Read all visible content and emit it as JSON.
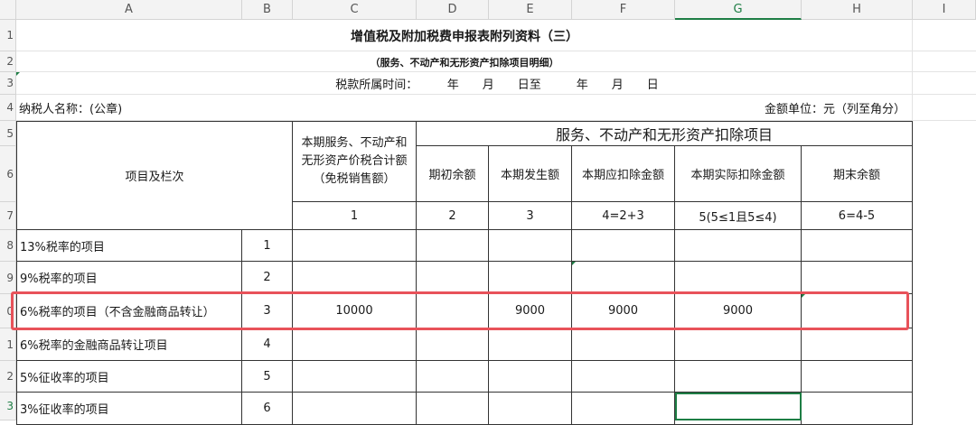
{
  "columns": [
    "A",
    "B",
    "C",
    "D",
    "E",
    "F",
    "G",
    "H",
    "I"
  ],
  "rows": [
    "1",
    "2",
    "3",
    "4",
    "5",
    "6",
    "7",
    "8",
    "9",
    "0",
    "1",
    "2",
    "3"
  ],
  "sheet": {
    "title": "增值税及附加税费申报表附列资料（三）",
    "subtitle": "（服务、不动产和无形资产扣除项目明细）",
    "period": "税款所属时间：　　　年　　月　　日至　　　年　　月　　日",
    "taxpayer": "纳税人名称：(公章)",
    "unit": "金额单位：元（列至角分）",
    "item_header": "项目及栏次",
    "col_c_header": "本期服务、不动产和无形资产价税合计额（免税销售额）",
    "group_header": "服务、不动产和无形资产扣除项目",
    "sub_headers": [
      "期初余额",
      "本期发生额",
      "本期应扣除金额",
      "本期实际扣除金额",
      "期末余额"
    ],
    "col_numbers": [
      "1",
      "2",
      "3",
      "4=2+3",
      "5(5≤1且5≤4)",
      "6=4-5"
    ],
    "items": [
      {
        "label": "13%税率的项目",
        "no": "1",
        "c": "",
        "d": "",
        "e": "",
        "f": "",
        "g": "",
        "h": ""
      },
      {
        "label": "9%税率的项目",
        "no": "2",
        "c": "",
        "d": "",
        "e": "",
        "f": "",
        "g": "",
        "h": ""
      },
      {
        "label": "6%税率的项目（不含金融商品转让）",
        "no": "3",
        "c": "10000",
        "d": "",
        "e": "9000",
        "f": "9000",
        "g": "9000",
        "h": ""
      },
      {
        "label": "6%税率的金融商品转让项目",
        "no": "4",
        "c": "",
        "d": "",
        "e": "",
        "f": "",
        "g": "",
        "h": ""
      },
      {
        "label": "5%征收率的项目",
        "no": "5",
        "c": "",
        "d": "",
        "e": "",
        "f": "",
        "g": "",
        "h": ""
      },
      {
        "label": "3%征收率的项目",
        "no": "6",
        "c": "",
        "d": "",
        "e": "",
        "f": "",
        "g": "",
        "h": ""
      }
    ]
  },
  "colors": {
    "highlight": "#e8525a",
    "selection": "#1e7e45"
  }
}
